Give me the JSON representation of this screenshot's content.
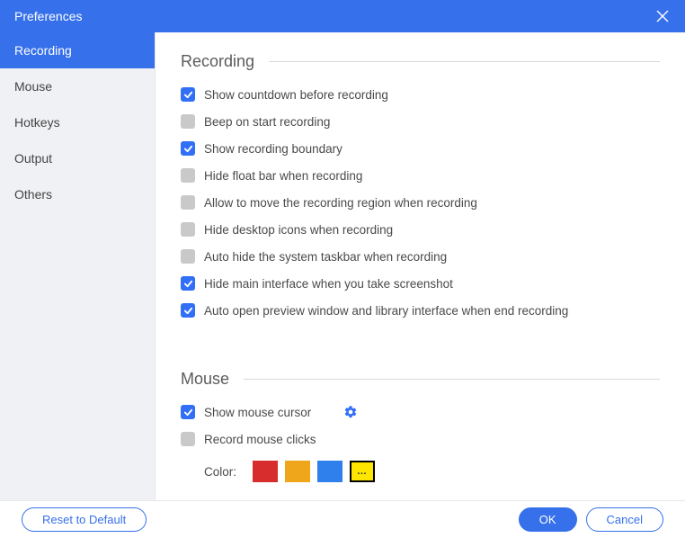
{
  "titlebar": {
    "title": "Preferences"
  },
  "sidebar": {
    "items": [
      {
        "label": "Recording",
        "active": true
      },
      {
        "label": "Mouse",
        "active": false
      },
      {
        "label": "Hotkeys",
        "active": false
      },
      {
        "label": "Output",
        "active": false
      },
      {
        "label": "Others",
        "active": false
      }
    ]
  },
  "sections": {
    "recording": {
      "title": "Recording",
      "options": [
        {
          "label": "Show countdown before recording",
          "checked": true
        },
        {
          "label": "Beep on start recording",
          "checked": false
        },
        {
          "label": "Show recording boundary",
          "checked": true
        },
        {
          "label": "Hide float bar when recording",
          "checked": false
        },
        {
          "label": "Allow to move the recording region when recording",
          "checked": false
        },
        {
          "label": "Hide desktop icons when recording",
          "checked": false
        },
        {
          "label": "Auto hide the system taskbar when recording",
          "checked": false
        },
        {
          "label": "Hide main interface when you take screenshot",
          "checked": true
        },
        {
          "label": "Auto open preview window and library interface when end recording",
          "checked": true
        }
      ]
    },
    "mouse": {
      "title": "Mouse",
      "options": [
        {
          "label": "Show mouse cursor",
          "checked": true,
          "has_gear": true
        },
        {
          "label": "Record mouse clicks",
          "checked": false
        }
      ],
      "color_label": "Color:",
      "colors": [
        "#d72d2d",
        "#f0a61a",
        "#2f80ed"
      ],
      "more_label": "…"
    }
  },
  "footer": {
    "reset": "Reset to Default",
    "ok": "OK",
    "cancel": "Cancel"
  }
}
